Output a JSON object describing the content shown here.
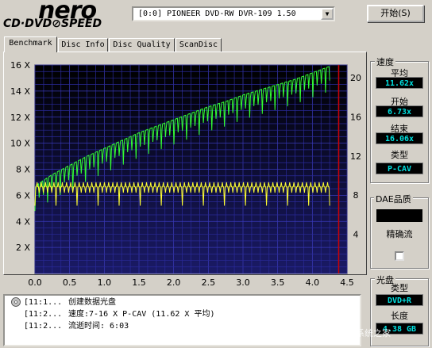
{
  "app": {
    "logo_main": "nero",
    "logo_sub": "CD·DVD⊘SPEED",
    "drive_select": "[0:0]   PIONEER DVD-RW  DVR-109 1.50",
    "start_button": "开始(S)"
  },
  "tabs": [
    {
      "label": "Benchmark",
      "active": true
    },
    {
      "label": "Disc Info",
      "active": false
    },
    {
      "label": "Disc Quality",
      "active": false
    },
    {
      "label": "ScanDisc",
      "active": false
    }
  ],
  "speed_panel": {
    "title": "速度",
    "average_label": "平均",
    "average_value": "11.62x",
    "start_label": "开始",
    "start_value": "6.73x",
    "end_label": "结束",
    "end_value": "16.06x",
    "type_label": "类型",
    "type_value": "P-CAV"
  },
  "dae_panel": {
    "title": "DAE品质",
    "accurate_stream_label": "精确流"
  },
  "disc_panel": {
    "title": "光盘",
    "type_label": "类型",
    "type_value": "DVD+R",
    "length_label": "长度",
    "length_value": "4.38 GB"
  },
  "log": [
    {
      "time": "[11:1...",
      "text": "创建数据光盘"
    },
    {
      "time": "[11:2...",
      "text": "速度:7-16 X P-CAV (11.62 X 平均)"
    },
    {
      "time": "[11:2...",
      "text": "流逝时间:  6:03"
    }
  ],
  "watermark": "系统之家",
  "colors": {
    "chart_bg_top": "#000000",
    "chart_bg_bottom": "#1a1a66",
    "grid": "#2a2a9a",
    "read_speed": "#33ff33",
    "rpm_curve": "#ffff33",
    "end_marker": "#cc0000",
    "value_text": "#00e0e0"
  },
  "chart_data": {
    "type": "line",
    "x_ticks": [
      "0.0",
      "0.5",
      "1.0",
      "1.5",
      "2.0",
      "2.5",
      "3.0",
      "3.5",
      "4.0",
      "4.5"
    ],
    "y_left_ticks": [
      "16 X",
      "14 X",
      "12 X",
      "10 X",
      "8 X",
      "6 X",
      "4 X",
      "2 X"
    ],
    "y_right_ticks": [
      "20",
      "16",
      "12",
      "8",
      "4"
    ],
    "xlim": [
      0,
      4.5
    ],
    "ylim": [
      0,
      16
    ],
    "y2lim": [
      0,
      21.3
    ],
    "end_marker_x": 4.38,
    "series": [
      {
        "x": [
          0.0,
          0.25,
          0.5,
          0.75,
          1.0,
          1.25,
          1.5,
          1.75,
          2.0,
          2.25,
          2.5,
          2.75,
          3.0,
          3.25,
          3.5,
          3.75,
          4.0,
          4.25
        ],
        "values": [
          6.7,
          7.6,
          8.3,
          9.0,
          9.6,
          10.2,
          10.8,
          11.3,
          11.8,
          12.3,
          12.8,
          13.2,
          13.7,
          14.1,
          14.5,
          14.9,
          15.4,
          15.9
        ]
      },
      {
        "x": [
          0.0,
          4.25
        ],
        "values": [
          6.8,
          6.8
        ]
      }
    ]
  }
}
